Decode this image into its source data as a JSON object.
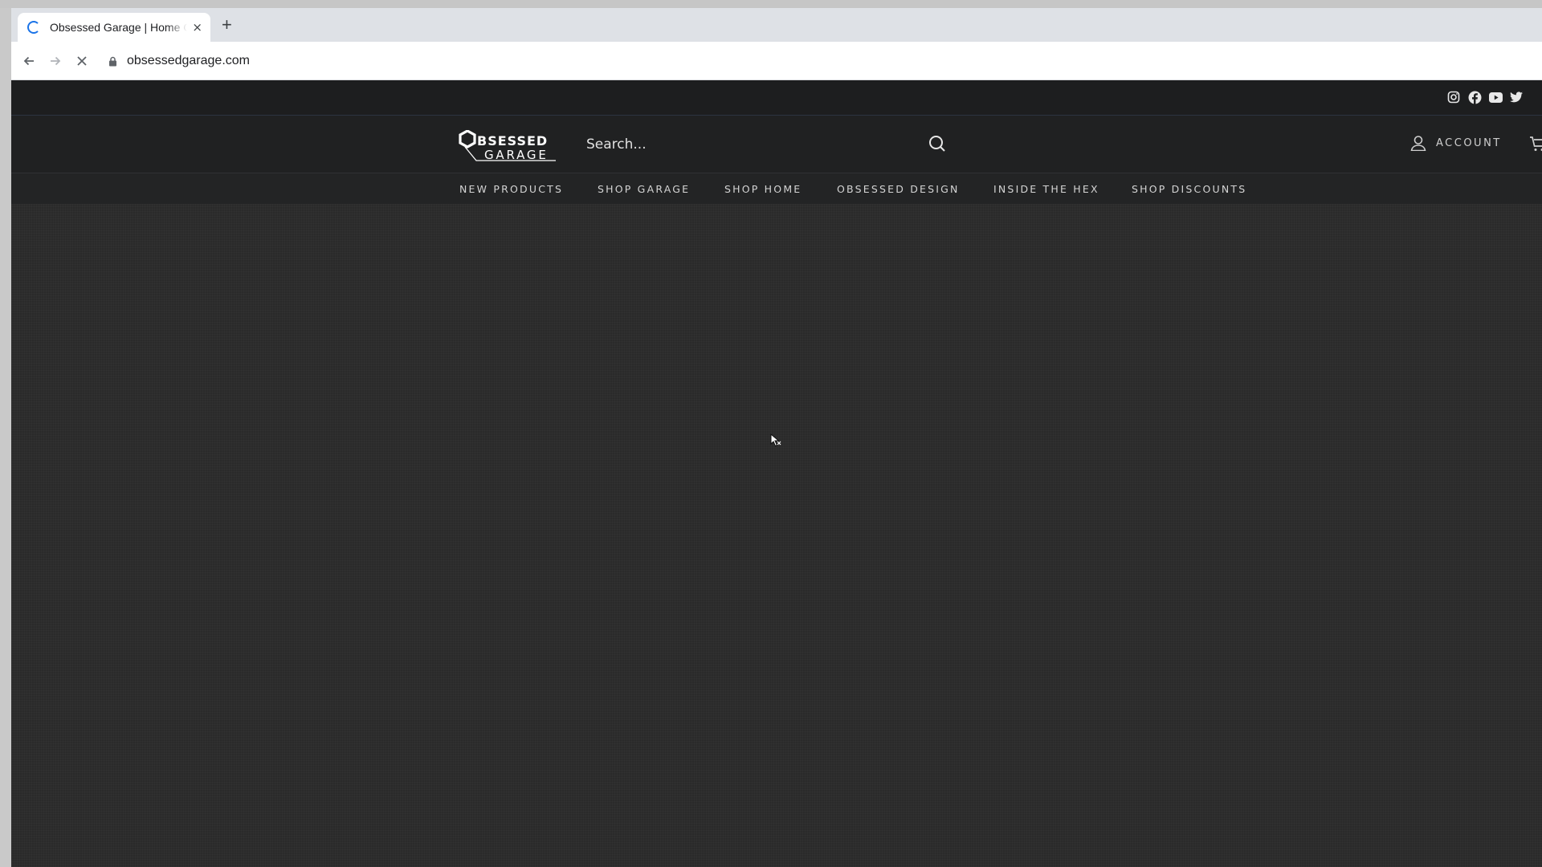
{
  "browser": {
    "tab_title": "Obsessed Garage | Home Garage Products",
    "new_tab_label": "+",
    "close_label": "×",
    "url": "obsessedgarage.com"
  },
  "site": {
    "brand": "Obsessed Garage",
    "logo_line1": "BSESSED",
    "logo_line2": "GARAGE",
    "social_icons": [
      "instagram-icon",
      "facebook-icon",
      "youtube-icon",
      "twitter-icon"
    ],
    "search": {
      "placeholder": "Search..."
    },
    "account_label": "ACCOUNT",
    "nav": [
      "NEW PRODUCTS",
      "SHOP GARAGE",
      "SHOP HOME",
      "OBSESSED DESIGN",
      "INSIDE THE HEX",
      "SHOP DISCOUNTS"
    ],
    "colors": {
      "background": "#2b2b2b",
      "header": "#202122",
      "text": "#d4d4d4",
      "tab_spinner": "#1a73e8"
    }
  }
}
